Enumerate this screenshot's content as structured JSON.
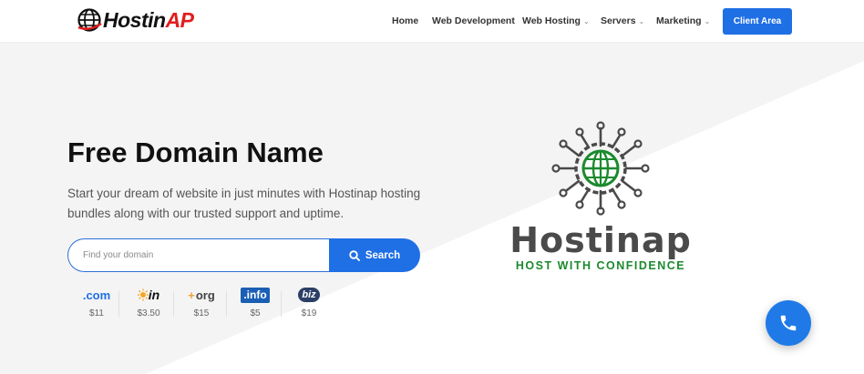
{
  "header": {
    "logo": {
      "part1": "Hostin",
      "part2": "AP"
    },
    "nav": [
      {
        "label": "Home",
        "has_dropdown": false
      },
      {
        "label": "Web Development",
        "has_dropdown": false
      },
      {
        "label": "Web Hosting",
        "has_dropdown": true
      },
      {
        "label": "Servers",
        "has_dropdown": true
      },
      {
        "label": "Marketing",
        "has_dropdown": true
      }
    ],
    "client_area_label": "Client Area"
  },
  "hero": {
    "title": "Free Domain Name",
    "subtitle": "Start your dream of website in just minutes with Hostinap hosting bundles along with our trusted support and uptime.",
    "search": {
      "placeholder": "Find your domain",
      "value": "",
      "button_label": "Search"
    },
    "tlds": [
      {
        "ext": ".com",
        "price": "$11"
      },
      {
        "ext": "in",
        "price": "$3.50"
      },
      {
        "ext": "org",
        "price": "$15"
      },
      {
        "ext": ".info",
        "price": "$5"
      },
      {
        "ext": "biz",
        "price": "$19"
      }
    ]
  },
  "brand": {
    "name": "Hostinap",
    "tagline": "HOST WITH CONFIDENCE"
  },
  "colors": {
    "accent": "#1f6fe5",
    "logo_red": "#e01e1e",
    "brand_green": "#1b8a2e",
    "brand_gray": "#4a4a4a"
  },
  "icons": {
    "search_button": "search-icon",
    "call_button": "phone-icon",
    "logo": "globe-icon"
  }
}
